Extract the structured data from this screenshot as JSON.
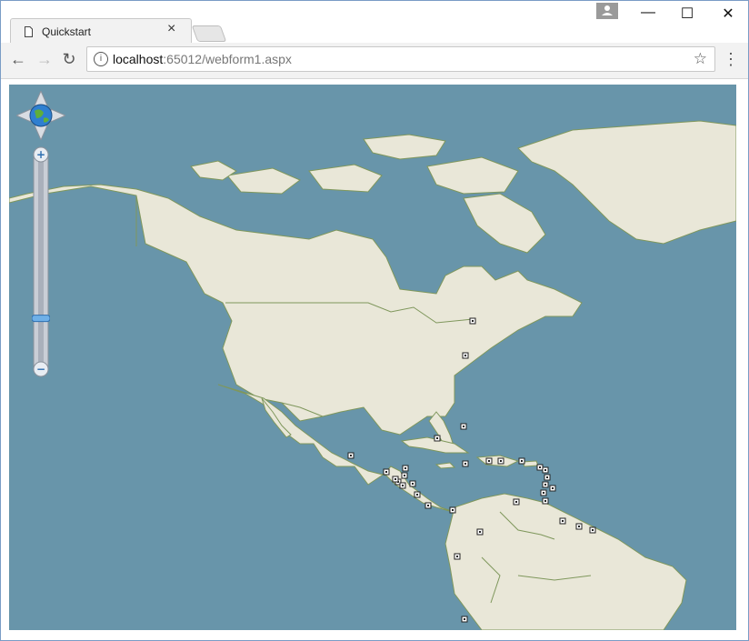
{
  "browser": {
    "tab": {
      "title": "Quickstart",
      "close": "×"
    },
    "address": {
      "host": "localhost",
      "rest": ":65012/webform1.aspx"
    },
    "nav": {
      "back": "←",
      "forward": "→",
      "reload": "↻",
      "star": "☆",
      "menu": "⋮"
    },
    "window": {
      "minimize": "—",
      "maximize": "☐",
      "close": "✕"
    }
  },
  "map": {
    "colors": {
      "ocean": "#6895aa",
      "land": "#e9e7d8",
      "border": "#7f975c"
    },
    "controls": {
      "zoom_in": "+",
      "zoom_out": "−",
      "zoom_level": 0.22
    },
    "marker_count": 33
  }
}
